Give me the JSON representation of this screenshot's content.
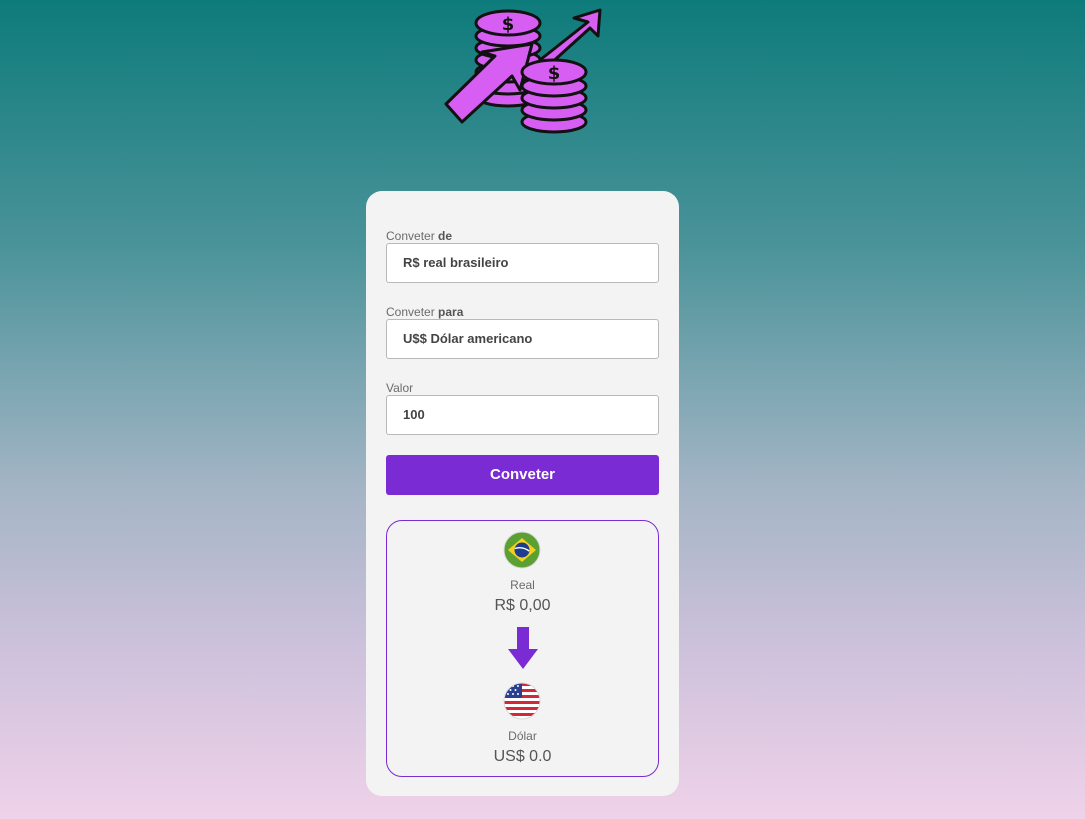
{
  "logo": {
    "icon": "money-coins-growth-icon"
  },
  "form": {
    "from": {
      "label_prefix": "Conveter",
      "label_bold": "de",
      "value": "R$ real brasileiro"
    },
    "to": {
      "label_prefix": "Conveter",
      "label_bold": "para",
      "value": "U$$ Dólar americano"
    },
    "amount": {
      "label": "Valor",
      "value": "100"
    },
    "convert_button": "Conveter"
  },
  "result": {
    "from": {
      "flag_icon": "brazil-flag-icon",
      "name": "Real",
      "value": "R$ 0,00"
    },
    "arrow_icon": "arrow-down-icon",
    "to": {
      "flag_icon": "usa-flag-icon",
      "name": "Dólar",
      "value": "US$ 0.0"
    }
  },
  "colors": {
    "accent": "#7a2bd4",
    "logo_purple": "#d65ef2",
    "card_background": "#f3f3f3"
  }
}
